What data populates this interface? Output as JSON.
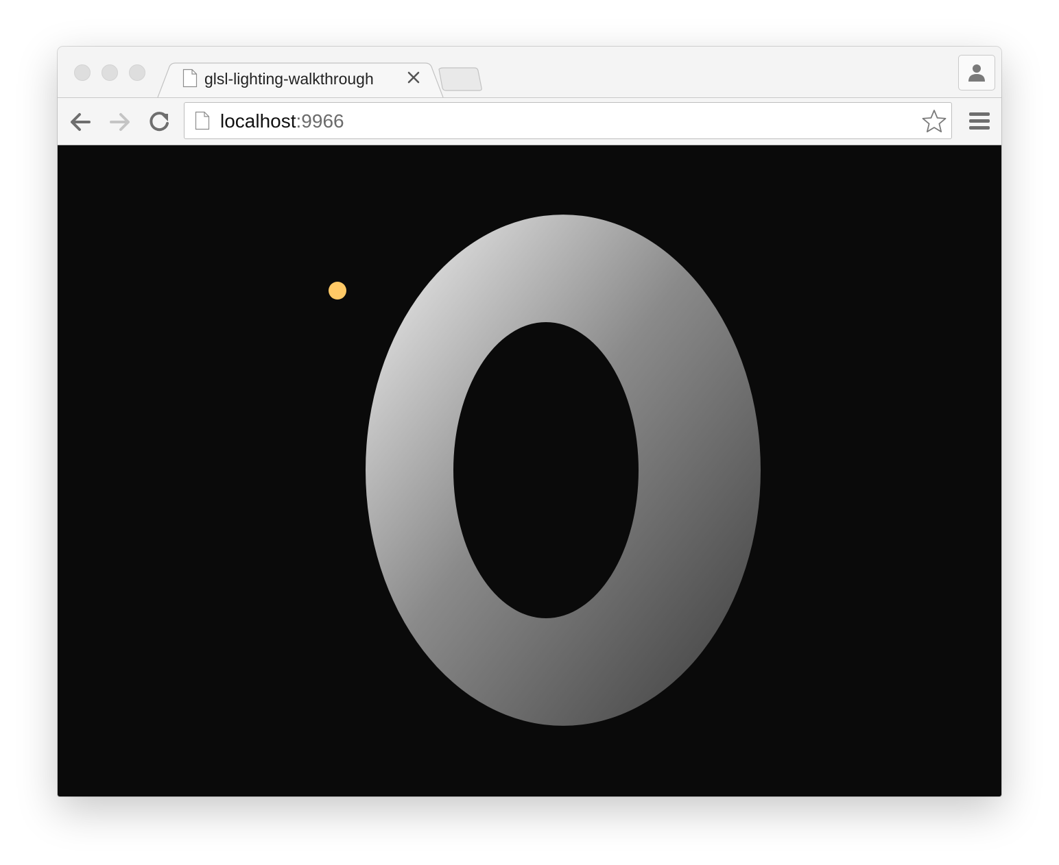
{
  "window": {
    "traffic_lights": [
      "close",
      "minimize",
      "zoom"
    ]
  },
  "tabs": [
    {
      "title": "glsl-lighting-walkthrough",
      "icon": "page-icon",
      "close_icon": "close-icon",
      "active": true
    }
  ],
  "new_tab_icon": "new-tab-icon",
  "profile_icon": "person-icon",
  "toolbar": {
    "back_icon": "arrow-left-icon",
    "forward_icon": "arrow-right-icon",
    "reload_icon": "reload-icon",
    "menu_icon": "hamburger-menu-icon"
  },
  "omnibox": {
    "host": "localhost",
    "port": ":9966",
    "page_icon": "page-icon",
    "bookmark_icon": "star-icon"
  },
  "scene": {
    "background_color": "#0a0a0a",
    "torus_light_color": "#d8d8d8",
    "torus_dark_color": "#4e4e4e",
    "light_color": "#ffc966"
  }
}
